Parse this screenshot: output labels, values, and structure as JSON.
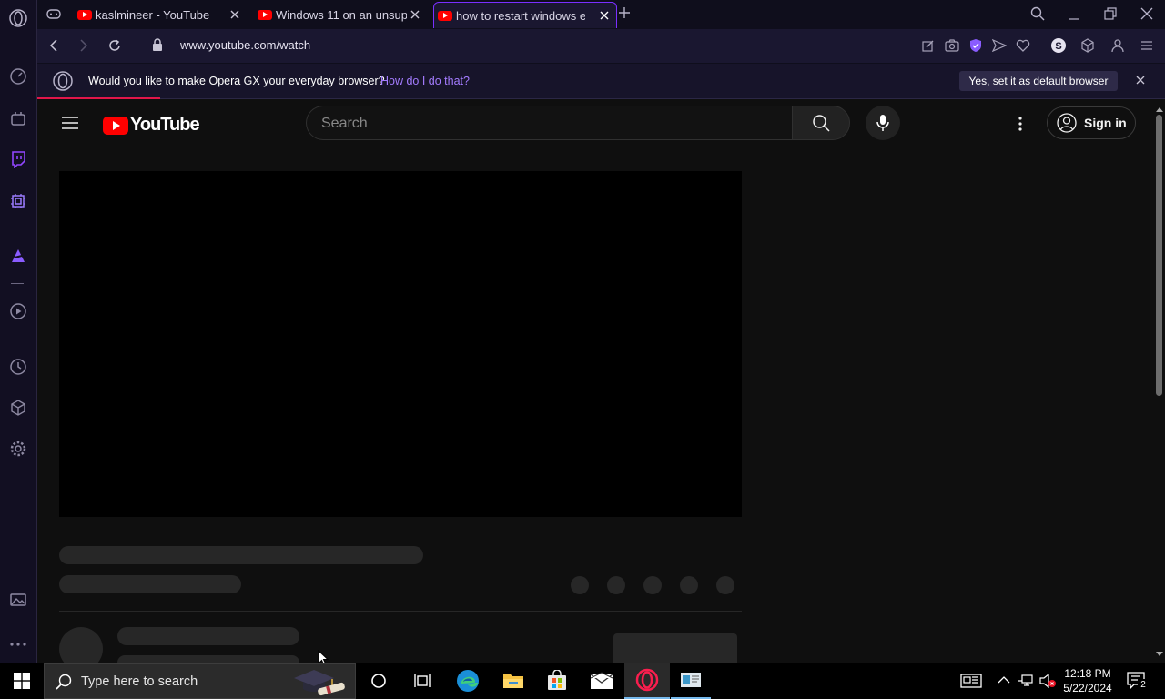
{
  "browser": {
    "tabs": [
      {
        "title": "kaslmineer - YouTube"
      },
      {
        "title": "Windows 11 on an unsupp"
      },
      {
        "title": "how to restart windows exp"
      }
    ],
    "url": "www.youtube.com/watch"
  },
  "infobar": {
    "message": "Would you like to make Opera GX your everyday browser?",
    "link": "How do I do that?",
    "button": "Yes, set it as default browser"
  },
  "youtube": {
    "logo_text": "YouTube",
    "search_placeholder": "Search",
    "sign_in": "Sign in"
  },
  "taskbar": {
    "search_placeholder": "Type here to search",
    "time": "12:18 PM",
    "date": "5/22/2024",
    "notification_count": "2"
  },
  "colors": {
    "opera_accent": "#7a2fff",
    "youtube_red": "#ff0000",
    "infobar_progress": "#e0164a"
  }
}
